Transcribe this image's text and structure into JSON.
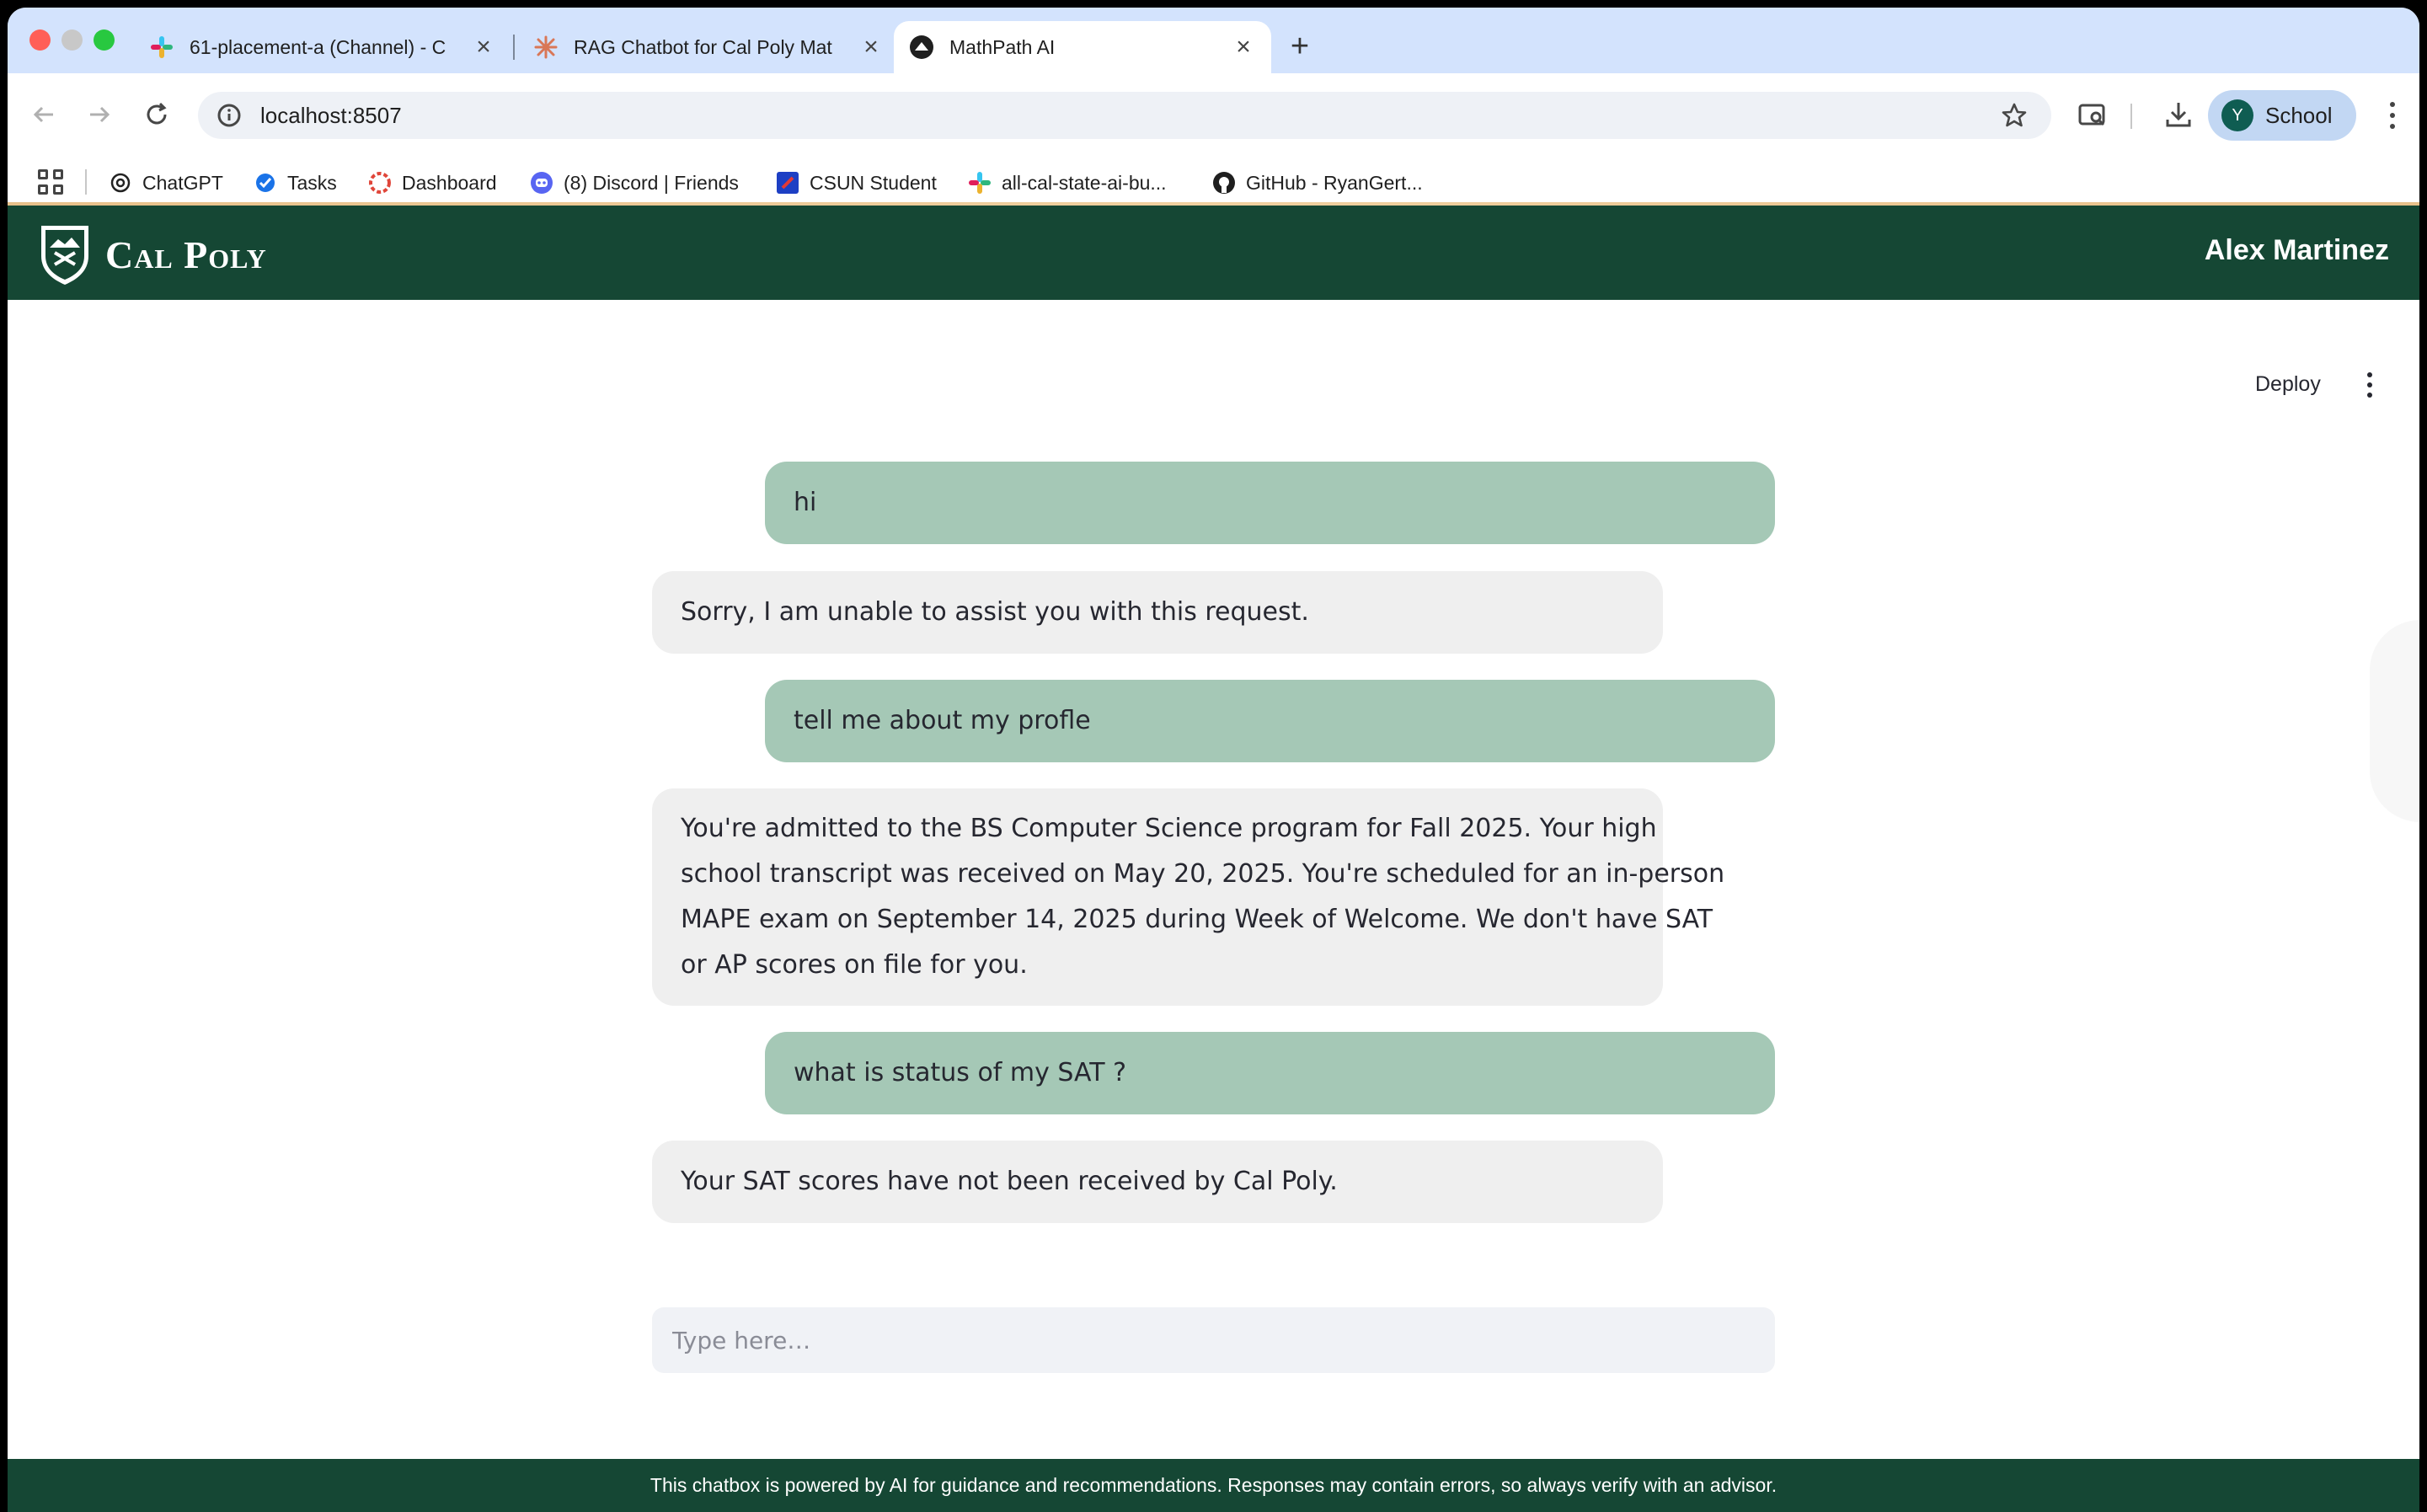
{
  "browser": {
    "tabs": [
      {
        "title": "61-placement-a (Channel) - C",
        "icon": "slack-icon"
      },
      {
        "title": "RAG Chatbot for Cal Poly Mat",
        "icon": "claude-icon"
      },
      {
        "title": "MathPath AI",
        "icon": "streamlit-icon",
        "active": true
      }
    ],
    "url": "localhost:8507",
    "profile": {
      "initial": "Y",
      "name": "School"
    },
    "bookmarks": [
      {
        "label": "ChatGPT",
        "icon": "chatgpt-icon"
      },
      {
        "label": "Tasks",
        "icon": "tasks-icon"
      },
      {
        "label": "Dashboard",
        "icon": "dashboard-icon"
      },
      {
        "label": "(8) Discord | Friends",
        "icon": "discord-icon"
      },
      {
        "label": "CSUN Student",
        "icon": "csun-icon"
      },
      {
        "label": "all-cal-state-ai-bu...",
        "icon": "slack-icon"
      },
      {
        "label": "GitHub - RyanGert...",
        "icon": "github-icon"
      }
    ]
  },
  "app": {
    "logo_text": "Cal Poly",
    "user_name": "Alex Martinez",
    "deploy_label": "Deploy",
    "messages": [
      {
        "role": "user",
        "text": "hi"
      },
      {
        "role": "assistant",
        "text": "Sorry, I am unable to assist you with this request."
      },
      {
        "role": "user",
        "text": "tell me about my profle"
      },
      {
        "role": "assistant",
        "lines": [
          "You're admitted to the BS Computer Science program for Fall 2025. Your high",
          "school transcript was received on May 20, 2025. You're scheduled for an in-person",
          "MAPE exam on September 14, 2025 during Week of Welcome. We don't have SAT",
          "or AP scores on file for you."
        ]
      },
      {
        "role": "user",
        "text": "what is status of my SAT ?"
      },
      {
        "role": "assistant",
        "text": "Your SAT scores have not been received by Cal Poly."
      }
    ],
    "input_placeholder": "Type here…",
    "footer_text": "This chatbox is powered by AI for guidance and recommendations. Responses may contain errors, so always verify with an advisor.",
    "colors": {
      "brand_green": "#154734",
      "user_bubble": "#a5c8b6",
      "bot_bubble": "#efefef"
    }
  }
}
